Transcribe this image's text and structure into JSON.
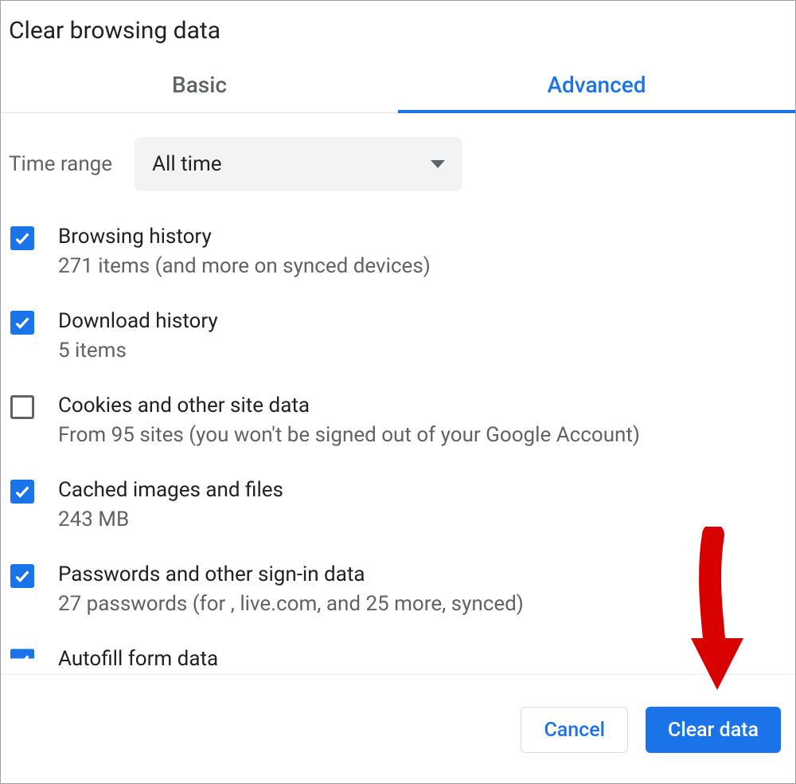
{
  "title": "Clear browsing data",
  "tabs": {
    "basic": "Basic",
    "advanced": "Advanced",
    "active": "advanced"
  },
  "time_range": {
    "label": "Time range",
    "value": "All time"
  },
  "items": [
    {
      "checked": true,
      "title": "Browsing history",
      "sub": "271 items (and more on synced devices)"
    },
    {
      "checked": true,
      "title": "Download history",
      "sub": "5 items"
    },
    {
      "checked": false,
      "title": "Cookies and other site data",
      "sub": "From 95 sites (you won't be signed out of your Google Account)"
    },
    {
      "checked": true,
      "title": "Cached images and files",
      "sub": "243 MB"
    },
    {
      "checked": true,
      "title": "Passwords and other sign-in data",
      "sub": "27 passwords (for , live.com, and 25 more, synced)"
    },
    {
      "checked": true,
      "title": "Autofill form data",
      "sub": ""
    }
  ],
  "buttons": {
    "cancel": "Cancel",
    "clear": "Clear data"
  }
}
